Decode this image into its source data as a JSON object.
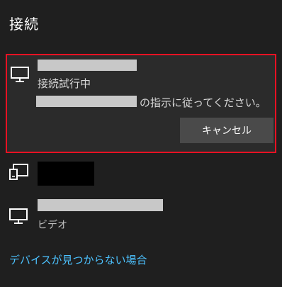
{
  "panel": {
    "title": "接続"
  },
  "devices": [
    {
      "icon": "monitor-icon",
      "status": "接続試行中",
      "instruction_suffix": "の指示に従ってください。",
      "cancel_label": "キャンセル",
      "selected": true
    },
    {
      "icon": "wireless-display-icon",
      "subtext": ""
    },
    {
      "icon": "monitor-icon",
      "subtext": "ビデオ"
    }
  ],
  "help_link": "デバイスが見つからない場合",
  "colors": {
    "background": "#1f1f1f",
    "selected_border": "#e81123",
    "link": "#4cc2ff",
    "button": "#4a4a4a"
  }
}
